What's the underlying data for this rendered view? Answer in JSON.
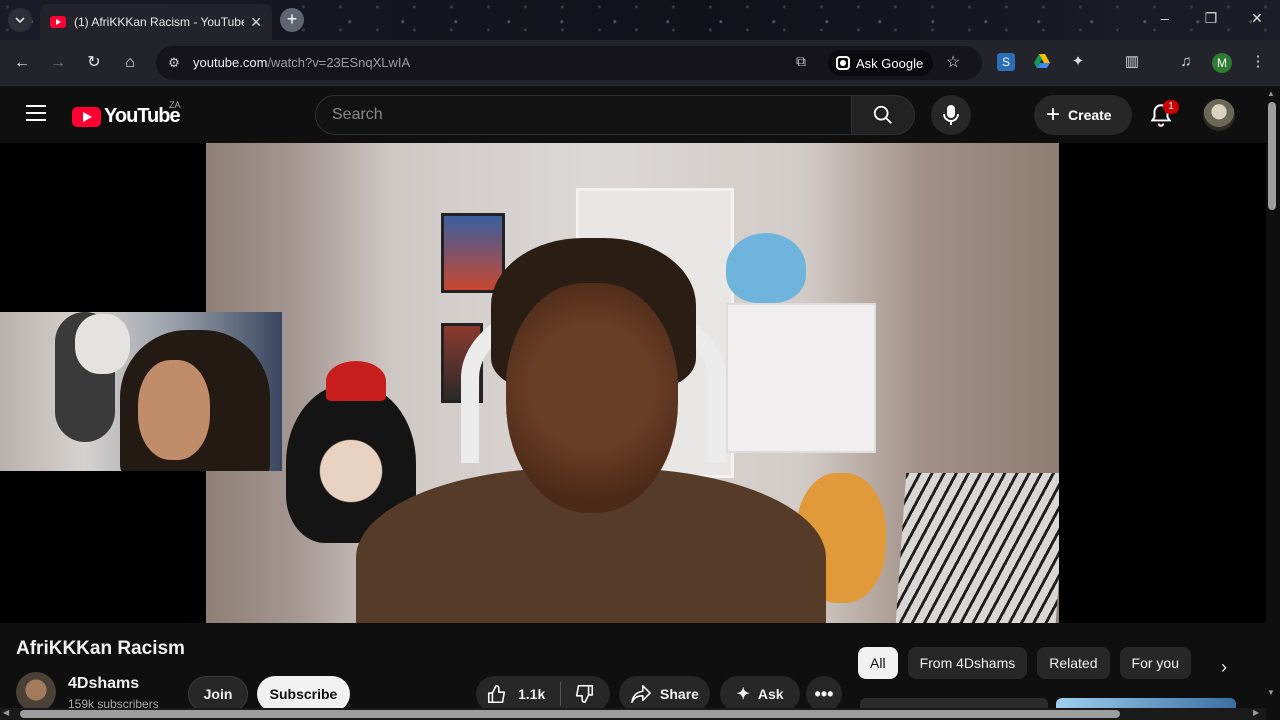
{
  "browser": {
    "tab_title": "(1) AfriKKKan Racism - YouTube",
    "tab_close": "✕",
    "new_tab": "+",
    "url_host": "youtube.com",
    "url_path": "/watch?v=23ESnqXLwIA",
    "ask_google": "Ask Google",
    "profile_initial": "M",
    "window_controls": [
      "–",
      "❐",
      "✕"
    ],
    "icons": [
      "back-icon",
      "forward-icon",
      "reload-icon",
      "home-icon",
      "site-info-icon",
      "install-icon",
      "star-icon",
      "extensions-icon",
      "sidebar-icon",
      "media-icon",
      "menu-icon"
    ]
  },
  "youtube": {
    "logo_text": "YouTube",
    "country_code": "ZA",
    "search_placeholder": "Search",
    "create_label": "Create",
    "notification_count": "1"
  },
  "video": {
    "title": "AfriKKKan Racism",
    "channel_name": "4Dshams",
    "subscribers": "159k subscribers",
    "join_label": "Join",
    "subscribe_label": "Subscribe",
    "likes": "1.1k",
    "share_label": "Share",
    "ask_label": "Ask",
    "more_label": "•••"
  },
  "chips": {
    "items": [
      "All",
      "From 4Dshams",
      "Related",
      "For you"
    ],
    "active_index": 0
  },
  "colors": {
    "brand_red": "#ff0033",
    "background": "#0f0f0f",
    "chip_bg": "#272727"
  }
}
